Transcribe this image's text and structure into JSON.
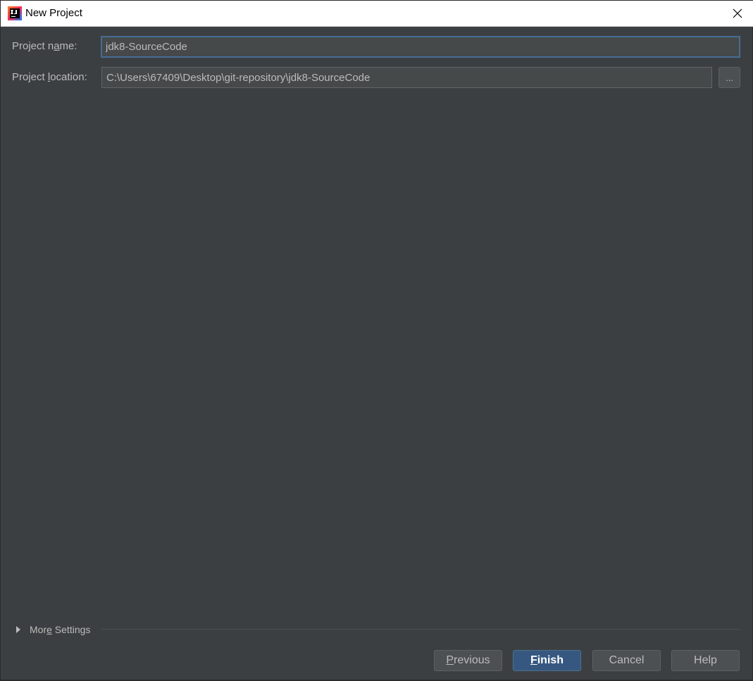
{
  "window": {
    "title": "New Project"
  },
  "form": {
    "project_name_label_pre": "Project n",
    "project_name_label_mn": "a",
    "project_name_label_post": "me:",
    "project_name_value": "jdk8-SourceCode",
    "project_location_label_pre": "Project ",
    "project_location_label_mn": "l",
    "project_location_label_post": "ocation:",
    "project_location_value": "C:\\Users\\67409\\Desktop\\git-repository\\jdk8-SourceCode",
    "browse_label": "..."
  },
  "more_settings": {
    "label_pre": "Mor",
    "label_mn": "e",
    "label_post": " Settings"
  },
  "buttons": {
    "previous_mn": "P",
    "previous_rest": "revious",
    "finish_mn": "F",
    "finish_rest": "inish",
    "cancel": "Cancel",
    "help": "Help"
  },
  "icons": {
    "app": "intellij-idea-icon",
    "close": "close-icon",
    "expand": "triangle-right-icon"
  },
  "colors": {
    "background": "#3c3f41",
    "field_background": "#45494a",
    "focus_border": "#466d94",
    "default_button": "#365880",
    "text": "#bbbbbb"
  }
}
